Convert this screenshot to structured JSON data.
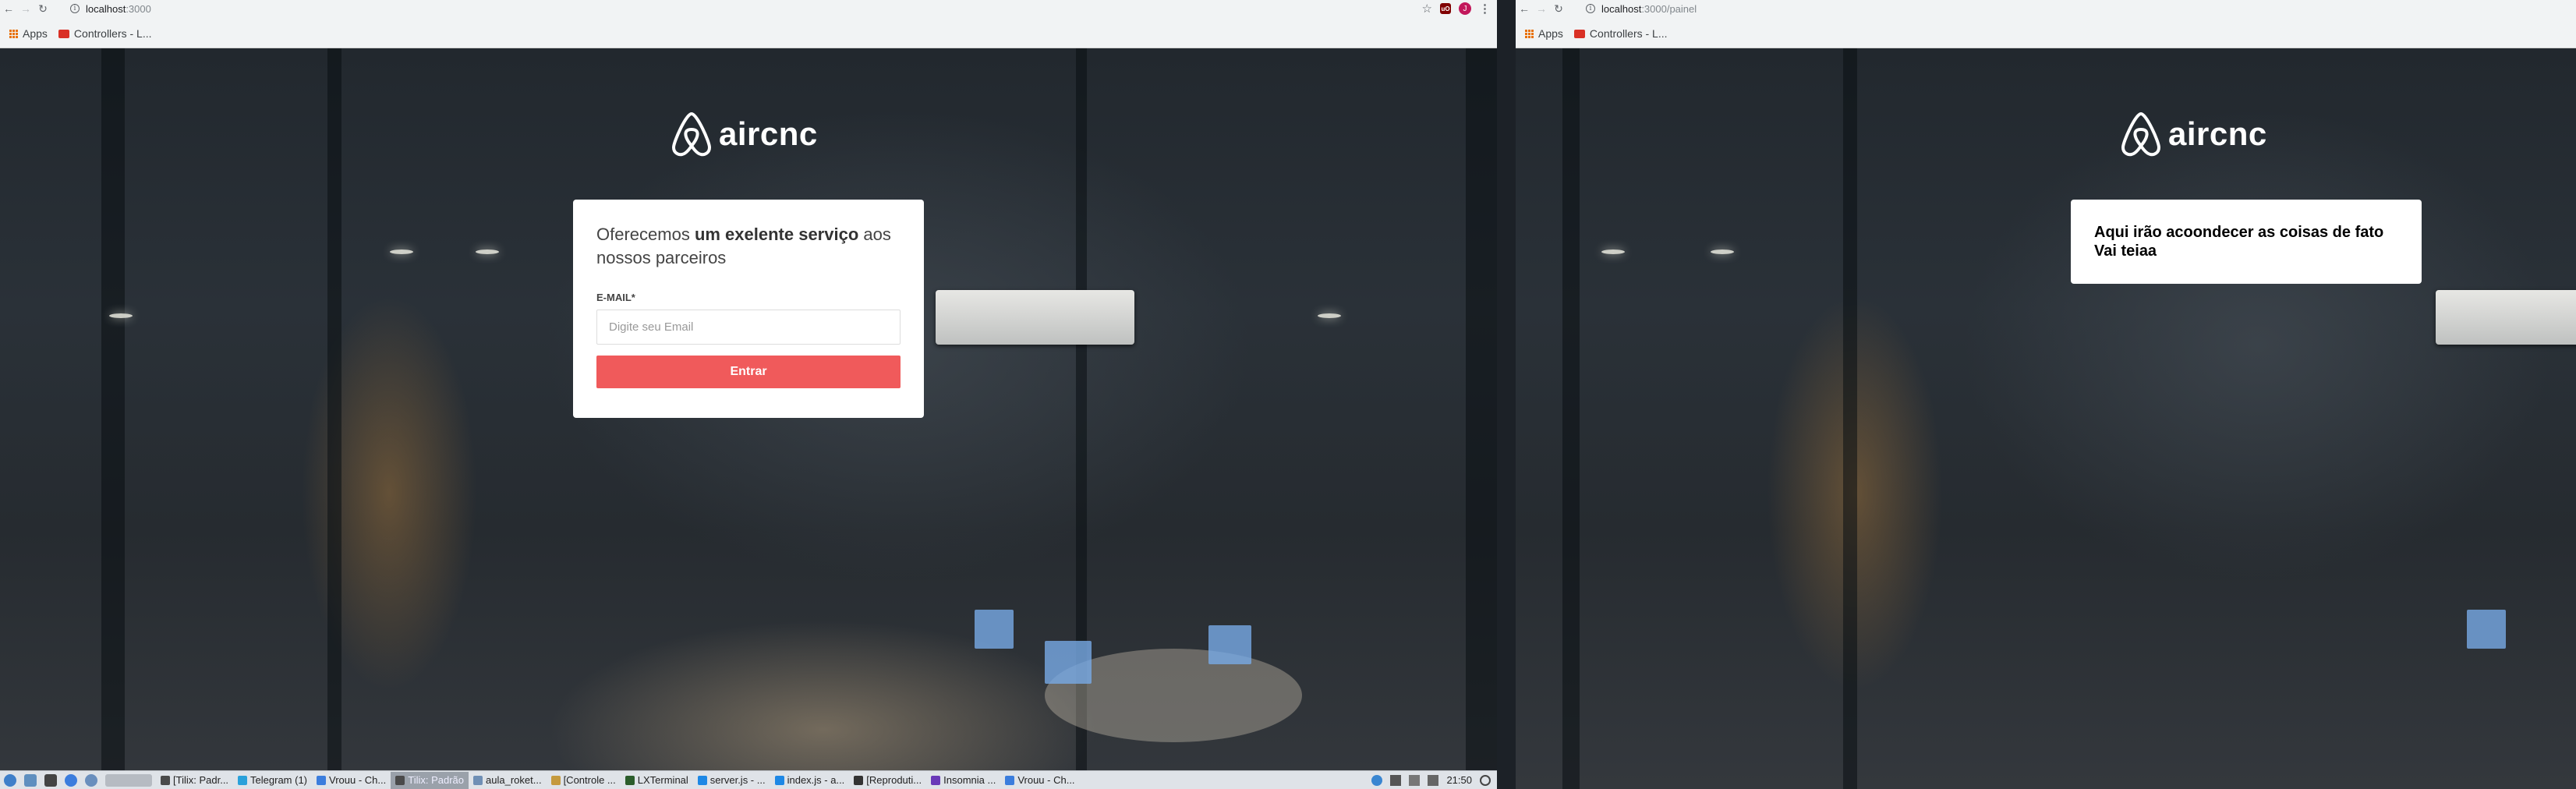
{
  "left_browser": {
    "url_host": "localhost",
    "url_path": ":3000",
    "bookmarks": [
      {
        "label": "Apps"
      },
      {
        "label": "Controllers - L..."
      }
    ],
    "profile_initial": "J"
  },
  "right_browser": {
    "url_host": "localhost",
    "url_path": ":3000/painel",
    "bookmarks": [
      {
        "label": "Apps"
      },
      {
        "label": "Controllers - L..."
      }
    ]
  },
  "logo": {
    "text": "aircnc"
  },
  "login_card": {
    "intro_pre": "Oferecemos ",
    "intro_bold": "um exelente serviço",
    "intro_post": " aos nossos parceiros",
    "email_label": "E-MAIL",
    "required_mark": "*",
    "email_placeholder": "Digite seu Email",
    "email_value": "",
    "submit_label": "Entrar"
  },
  "painel_card": {
    "line1": "Aqui irão acoondecer as coisas de fato",
    "line2": "Vai teiaa"
  },
  "colors": {
    "accent": "#f05a5b",
    "card_bg": "#ffffff",
    "chrome_bg": "#f1f3f4"
  },
  "taskbar": {
    "tasks": [
      {
        "label": "[Tilix: Padr...",
        "icon": "terminal-icon",
        "color": "#4a4a4a",
        "active": false
      },
      {
        "label": "Telegram (1)",
        "icon": "telegram-icon",
        "color": "#2aa1da",
        "active": false
      },
      {
        "label": "Vrouu - Ch...",
        "icon": "chrome-icon",
        "color": "#3b7ddd",
        "active": false
      },
      {
        "label": "Tilix: Padrão",
        "icon": "terminal-icon",
        "color": "#4a4a4a",
        "active": true
      },
      {
        "label": "aula_roket...",
        "icon": "folder-icon",
        "color": "#6f8fb5",
        "active": false
      },
      {
        "label": "[Controle ...",
        "icon": "file-manager-icon",
        "color": "#c59a3e",
        "active": false
      },
      {
        "label": "LXTerminal",
        "icon": "terminal-icon",
        "color": "#2b5d2b",
        "active": false
      },
      {
        "label": "server.js - ...",
        "icon": "vscode-icon",
        "color": "#1e88e5",
        "active": false
      },
      {
        "label": "index.js - a...",
        "icon": "vscode-icon",
        "color": "#1e88e5",
        "active": false
      },
      {
        "label": "[Reproduti...",
        "icon": "media-player-icon",
        "color": "#333333",
        "active": false
      },
      {
        "label": "Insomnia ...",
        "icon": "insomnia-icon",
        "color": "#6a39b8",
        "active": false
      },
      {
        "label": "Vrouu - Ch...",
        "icon": "chrome-icon",
        "color": "#3b7ddd",
        "active": false
      }
    ],
    "clock": "21:50"
  }
}
